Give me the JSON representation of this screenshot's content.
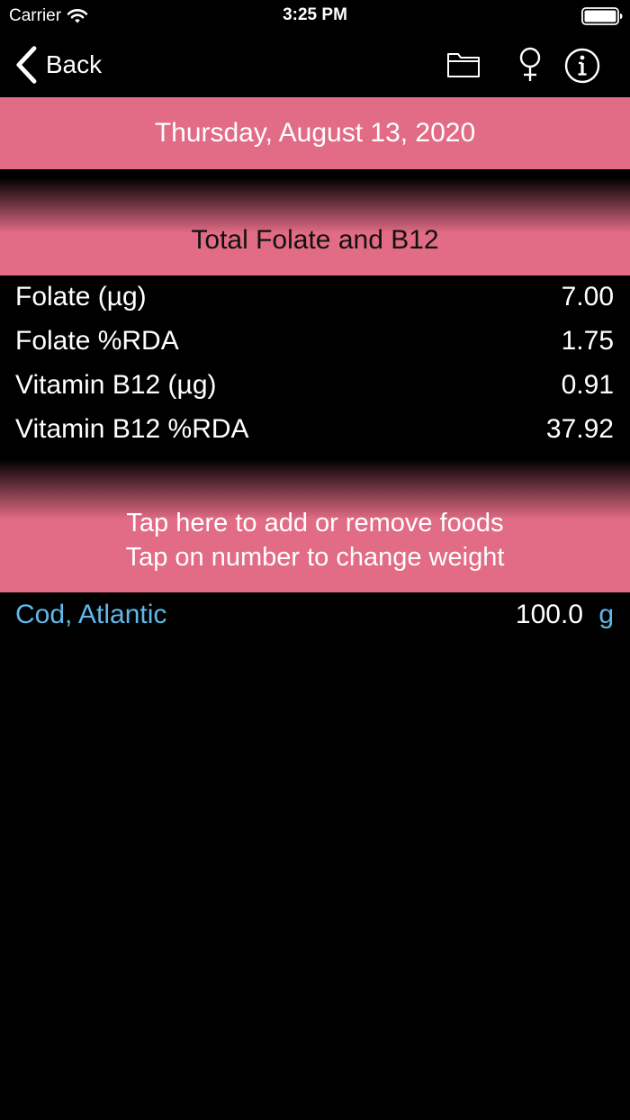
{
  "status_bar": {
    "carrier": "Carrier",
    "time": "3:25 PM"
  },
  "nav": {
    "back_label": "Back",
    "icons": [
      "folder-icon",
      "female-symbol-icon",
      "info-icon"
    ]
  },
  "date_banner": "Thursday, August 13, 2020",
  "totals": {
    "title": "Total Folate and B12",
    "rows": [
      {
        "label": "Folate (µg)",
        "value": "7.00"
      },
      {
        "label": "Folate %RDA",
        "value": "1.75"
      },
      {
        "label": "Vitamin B12 (µg)",
        "value": "0.91"
      },
      {
        "label": "Vitamin B12 %RDA",
        "value": "37.92"
      }
    ]
  },
  "foods": {
    "instruction_line1": "Tap here to add or remove foods",
    "instruction_line2": "Tap on number to change weight",
    "items": [
      {
        "name": "Cod, Atlantic",
        "weight": "100.0",
        "unit": "g"
      }
    ]
  },
  "colors": {
    "accent_pink": "#e26b85",
    "link_blue": "#5fb8e8",
    "background": "#000000"
  }
}
